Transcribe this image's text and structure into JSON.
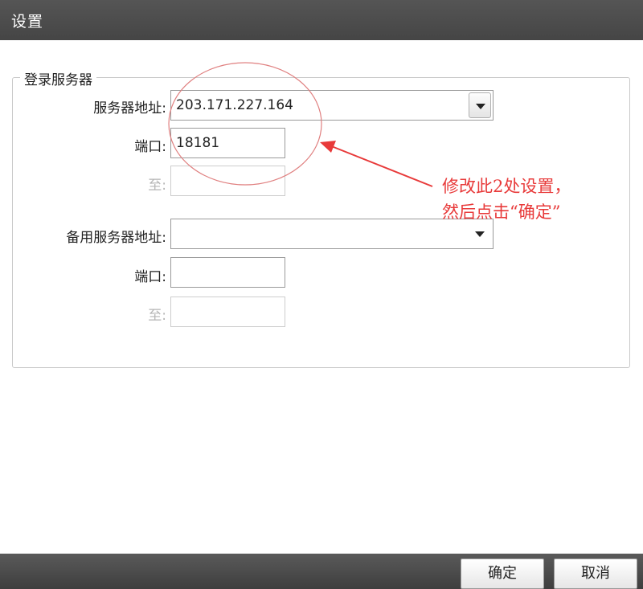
{
  "window": {
    "title": "设置"
  },
  "primary_group": {
    "legend": "登录服务器",
    "server_label": "服务器地址:",
    "server_value": "203.171.227.164",
    "port_label": "端口:",
    "port_value": "18181",
    "to_label": "至:",
    "to_value": ""
  },
  "backup_group": {
    "server_label": "备用服务器地址:",
    "server_value": "",
    "port_label": "端口:",
    "port_value": "",
    "to_label": "至:",
    "to_value": ""
  },
  "annotation": {
    "line1": "修改此2处设置，",
    "line2": "然后点击“确定”",
    "color": "#e83a3a"
  },
  "buttons": {
    "ok": "确定",
    "cancel": "取消"
  },
  "icons": {
    "dropdown": "chevron-down-icon"
  },
  "colors": {
    "titlebar": "#4d4d4d",
    "annotation": "#e83a3a"
  }
}
